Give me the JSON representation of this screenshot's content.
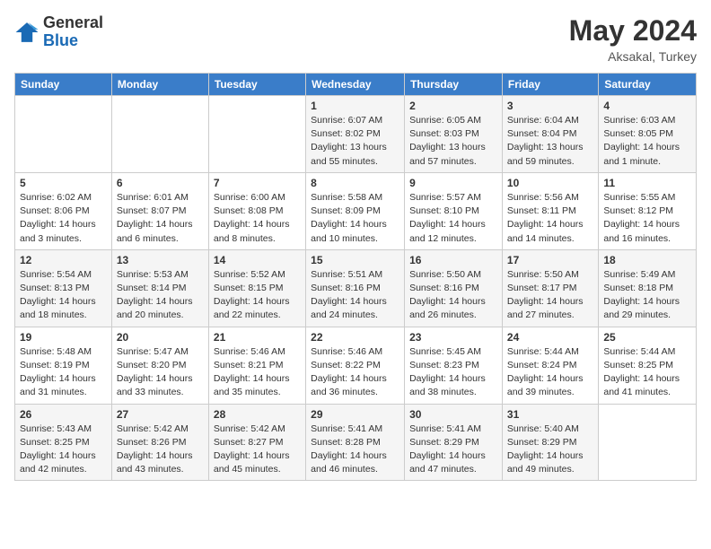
{
  "header": {
    "logo_general": "General",
    "logo_blue": "Blue",
    "month_year": "May 2024",
    "location": "Aksakal, Turkey"
  },
  "days_of_week": [
    "Sunday",
    "Monday",
    "Tuesday",
    "Wednesday",
    "Thursday",
    "Friday",
    "Saturday"
  ],
  "weeks": [
    [
      null,
      null,
      null,
      {
        "day": "1",
        "sunrise": "6:07 AM",
        "sunset": "8:02 PM",
        "daylight": "13 hours and 55 minutes"
      },
      {
        "day": "2",
        "sunrise": "6:05 AM",
        "sunset": "8:03 PM",
        "daylight": "13 hours and 57 minutes"
      },
      {
        "day": "3",
        "sunrise": "6:04 AM",
        "sunset": "8:04 PM",
        "daylight": "13 hours and 59 minutes"
      },
      {
        "day": "4",
        "sunrise": "6:03 AM",
        "sunset": "8:05 PM",
        "daylight": "14 hours and 1 minute"
      }
    ],
    [
      {
        "day": "5",
        "sunrise": "6:02 AM",
        "sunset": "8:06 PM",
        "daylight": "14 hours and 3 minutes"
      },
      {
        "day": "6",
        "sunrise": "6:01 AM",
        "sunset": "8:07 PM",
        "daylight": "14 hours and 6 minutes"
      },
      {
        "day": "7",
        "sunrise": "6:00 AM",
        "sunset": "8:08 PM",
        "daylight": "14 hours and 8 minutes"
      },
      {
        "day": "8",
        "sunrise": "5:58 AM",
        "sunset": "8:09 PM",
        "daylight": "14 hours and 10 minutes"
      },
      {
        "day": "9",
        "sunrise": "5:57 AM",
        "sunset": "8:10 PM",
        "daylight": "14 hours and 12 minutes"
      },
      {
        "day": "10",
        "sunrise": "5:56 AM",
        "sunset": "8:11 PM",
        "daylight": "14 hours and 14 minutes"
      },
      {
        "day": "11",
        "sunrise": "5:55 AM",
        "sunset": "8:12 PM",
        "daylight": "14 hours and 16 minutes"
      }
    ],
    [
      {
        "day": "12",
        "sunrise": "5:54 AM",
        "sunset": "8:13 PM",
        "daylight": "14 hours and 18 minutes"
      },
      {
        "day": "13",
        "sunrise": "5:53 AM",
        "sunset": "8:14 PM",
        "daylight": "14 hours and 20 minutes"
      },
      {
        "day": "14",
        "sunrise": "5:52 AM",
        "sunset": "8:15 PM",
        "daylight": "14 hours and 22 minutes"
      },
      {
        "day": "15",
        "sunrise": "5:51 AM",
        "sunset": "8:16 PM",
        "daylight": "14 hours and 24 minutes"
      },
      {
        "day": "16",
        "sunrise": "5:50 AM",
        "sunset": "8:16 PM",
        "daylight": "14 hours and 26 minutes"
      },
      {
        "day": "17",
        "sunrise": "5:50 AM",
        "sunset": "8:17 PM",
        "daylight": "14 hours and 27 minutes"
      },
      {
        "day": "18",
        "sunrise": "5:49 AM",
        "sunset": "8:18 PM",
        "daylight": "14 hours and 29 minutes"
      }
    ],
    [
      {
        "day": "19",
        "sunrise": "5:48 AM",
        "sunset": "8:19 PM",
        "daylight": "14 hours and 31 minutes"
      },
      {
        "day": "20",
        "sunrise": "5:47 AM",
        "sunset": "8:20 PM",
        "daylight": "14 hours and 33 minutes"
      },
      {
        "day": "21",
        "sunrise": "5:46 AM",
        "sunset": "8:21 PM",
        "daylight": "14 hours and 35 minutes"
      },
      {
        "day": "22",
        "sunrise": "5:46 AM",
        "sunset": "8:22 PM",
        "daylight": "14 hours and 36 minutes"
      },
      {
        "day": "23",
        "sunrise": "5:45 AM",
        "sunset": "8:23 PM",
        "daylight": "14 hours and 38 minutes"
      },
      {
        "day": "24",
        "sunrise": "5:44 AM",
        "sunset": "8:24 PM",
        "daylight": "14 hours and 39 minutes"
      },
      {
        "day": "25",
        "sunrise": "5:44 AM",
        "sunset": "8:25 PM",
        "daylight": "14 hours and 41 minutes"
      }
    ],
    [
      {
        "day": "26",
        "sunrise": "5:43 AM",
        "sunset": "8:25 PM",
        "daylight": "14 hours and 42 minutes"
      },
      {
        "day": "27",
        "sunrise": "5:42 AM",
        "sunset": "8:26 PM",
        "daylight": "14 hours and 43 minutes"
      },
      {
        "day": "28",
        "sunrise": "5:42 AM",
        "sunset": "8:27 PM",
        "daylight": "14 hours and 45 minutes"
      },
      {
        "day": "29",
        "sunrise": "5:41 AM",
        "sunset": "8:28 PM",
        "daylight": "14 hours and 46 minutes"
      },
      {
        "day": "30",
        "sunrise": "5:41 AM",
        "sunset": "8:29 PM",
        "daylight": "14 hours and 47 minutes"
      },
      {
        "day": "31",
        "sunrise": "5:40 AM",
        "sunset": "8:29 PM",
        "daylight": "14 hours and 49 minutes"
      },
      null
    ]
  ]
}
